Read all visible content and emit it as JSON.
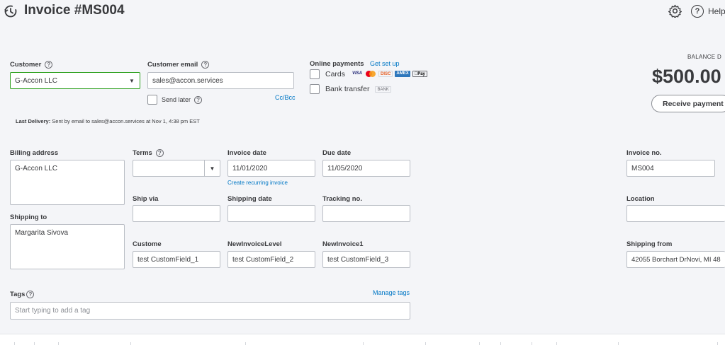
{
  "header": {
    "title": "Invoice #MS004",
    "help_label": "Help",
    "history_icon": "history-clock-icon",
    "settings_icon": "gear-icon",
    "help_icon": "question-circle-icon"
  },
  "customer": {
    "label": "Customer",
    "value": "G-Accon LLC"
  },
  "customer_email": {
    "label": "Customer email",
    "value": "sales@accon.services",
    "send_later_label": "Send later",
    "cc_bcc_label": "Cc/Bcc"
  },
  "online_payments": {
    "label": "Online payments",
    "get_set_up": "Get set up",
    "cards_label": "Cards",
    "card_brands": [
      "VISA",
      "MC",
      "DISC",
      "AMEX",
      "Pay"
    ],
    "bank_transfer_label": "Bank transfer",
    "bank_badge": "BANK"
  },
  "balance": {
    "label": "BALANCE D",
    "amount": "$500.00",
    "receive_payment_label": "Receive payment"
  },
  "last_delivery": {
    "label": "Last Delivery:",
    "text": "Sent by email to sales@accon.services at Nov 1, 4:38 pm EST"
  },
  "billing": {
    "label": "Billing address",
    "value": "G-Accon LLC"
  },
  "shipping_to": {
    "label": "Shipping to",
    "value": "Margarita Sivova"
  },
  "terms": {
    "label": "Terms",
    "value": ""
  },
  "invoice_date": {
    "label": "Invoice date",
    "value": "11/01/2020",
    "recurring_link": "Create recurring invoice"
  },
  "due_date": {
    "label": "Due date",
    "value": "11/05/2020"
  },
  "invoice_no": {
    "label": "Invoice no.",
    "value": "MS004"
  },
  "ship_via": {
    "label": "Ship via",
    "value": ""
  },
  "shipping_date": {
    "label": "Shipping date",
    "value": ""
  },
  "tracking_no": {
    "label": "Tracking no.",
    "value": ""
  },
  "location": {
    "label": "Location",
    "value": ""
  },
  "custom_fields": [
    {
      "label": "Custome",
      "value": "test CustomField_1"
    },
    {
      "label": "NewInvoiceLevel",
      "value": "test CustomField_2"
    },
    {
      "label": "NewInvoice1",
      "value": "test CustomField_3"
    }
  ],
  "shipping_from": {
    "label": "Shipping from",
    "value": "42055 Borchart DrNovi, MI  48"
  },
  "tags": {
    "label": "Tags",
    "manage_label": "Manage tags",
    "placeholder": "Start typing to add a tag"
  },
  "colors": {
    "accent_green": "#2ca01c",
    "link_blue": "#0077c5",
    "background": "#f4f5f8"
  }
}
